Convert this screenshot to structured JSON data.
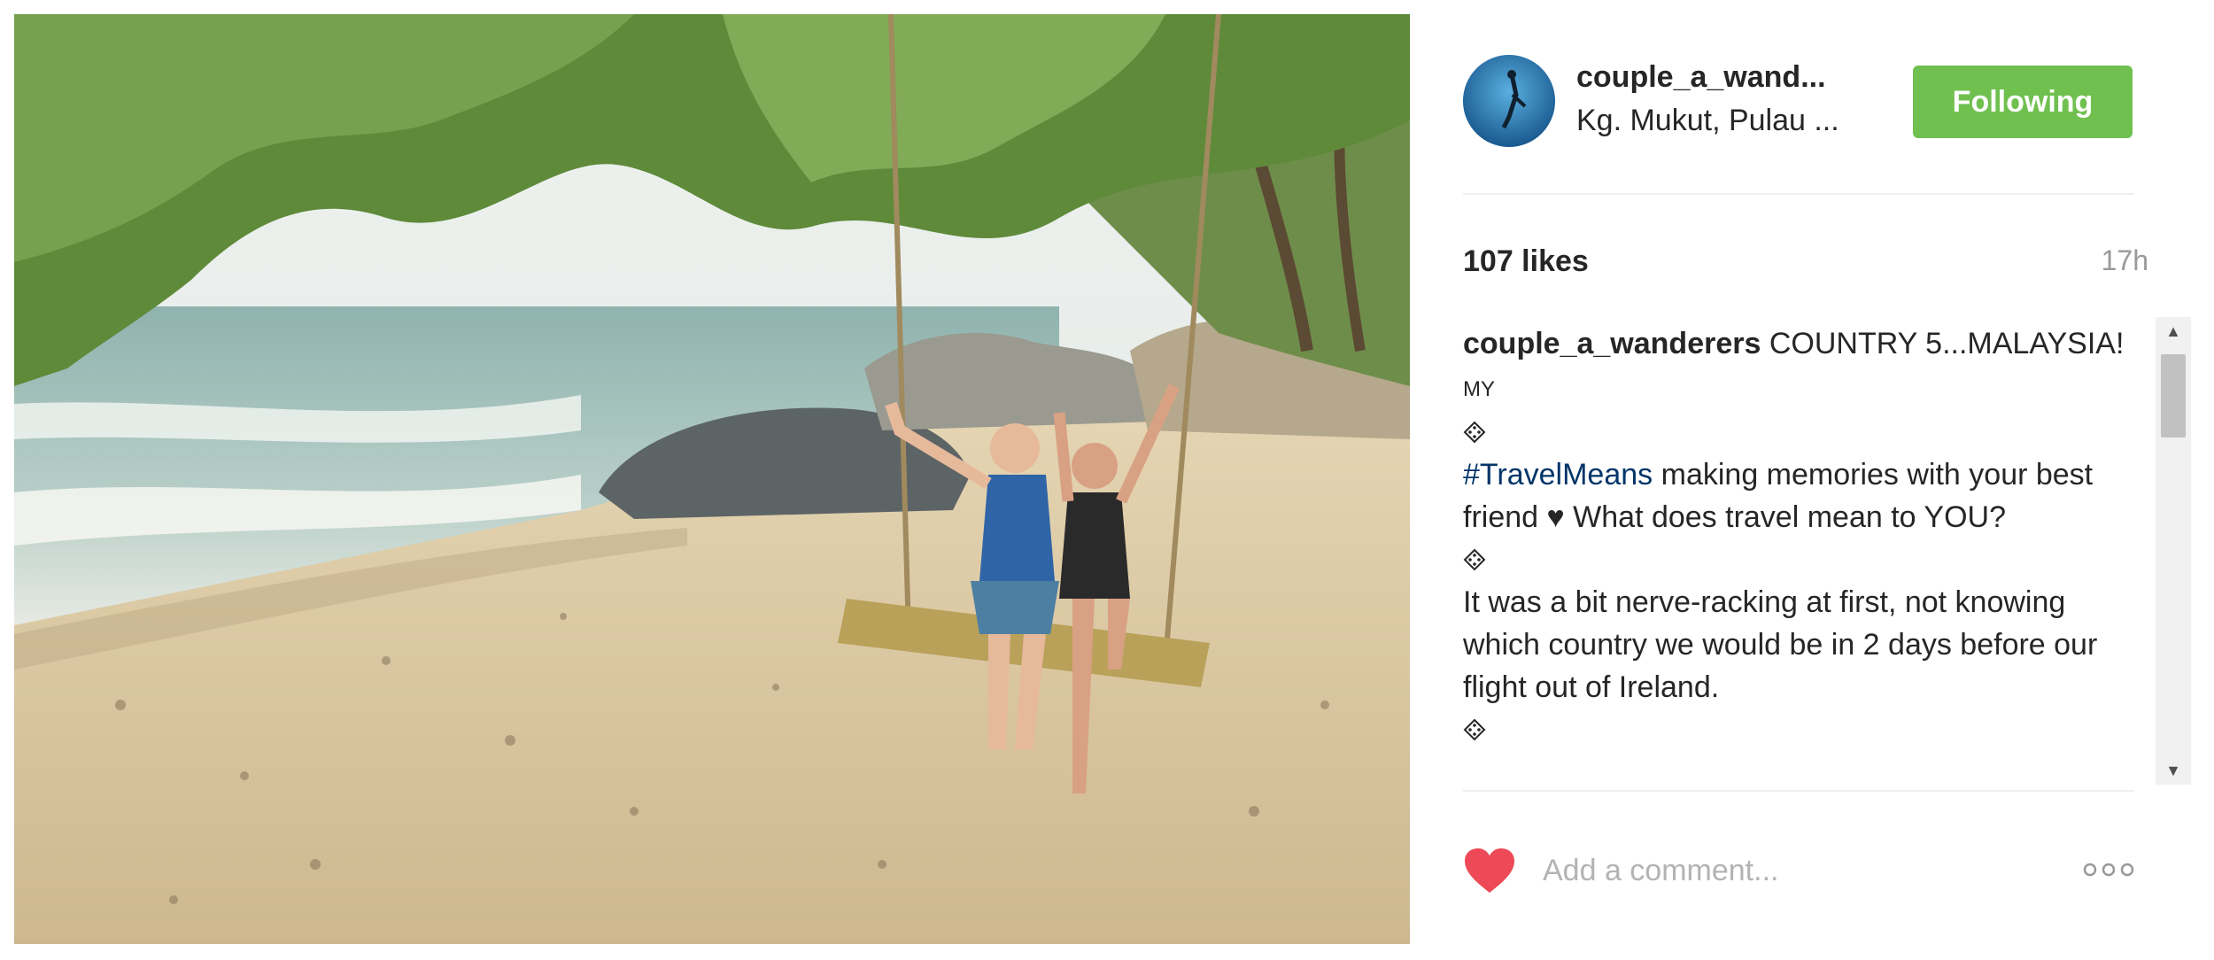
{
  "post": {
    "photo_icon": "beach-swing-photo",
    "account": {
      "username": "couple_a_wand...",
      "location": "Kg. Mukut, Pulau ...",
      "follow_label": "Following",
      "avatar_icon": "diver-avatar"
    },
    "likes": "107 likes",
    "time": "17h",
    "caption": {
      "username": "couple_a_wanderers",
      "text1": "COUNTRY 5...MALAYSIA!",
      "flag": "MY",
      "hashtag": "#TravelMeans",
      "text2": "making memories with your best friend",
      "heart": "♥",
      "text3": "What does travel mean to YOU?",
      "text4": "It was a bit nerve-racking at first, not knowing which country we would be in 2 days before our flight out of Ireland."
    },
    "comment": {
      "placeholder": "Add a comment...",
      "like_icon": "heart-icon",
      "more_icon": "more-options-icon"
    }
  },
  "colors": {
    "follow_button": "#70c050",
    "hashtag": "#003569",
    "like_heart": "#ed4956",
    "muted_text": "#999999"
  }
}
